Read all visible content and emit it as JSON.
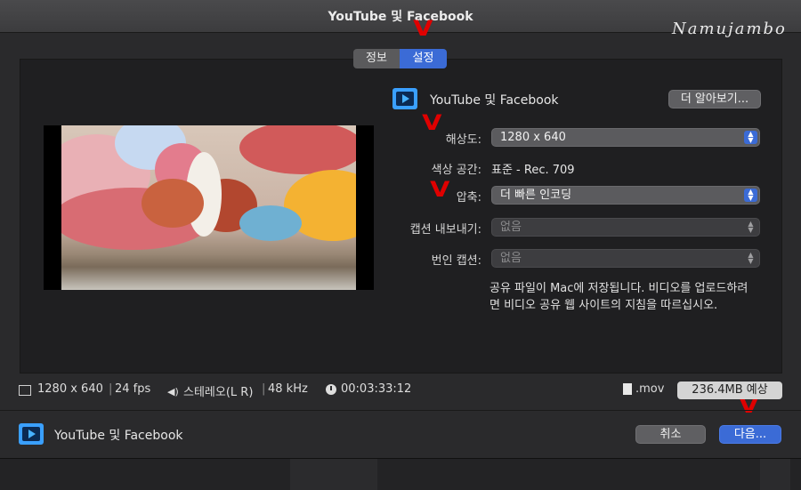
{
  "window": {
    "title": "YouTube 및 Facebook"
  },
  "watermark": "Namujambo",
  "tabs": [
    {
      "label": "정보",
      "selected": false
    },
    {
      "label": "설정",
      "selected": true
    }
  ],
  "destination": {
    "name": "YouTube 및 Facebook",
    "learn_more": "더 알아보기..."
  },
  "settings": {
    "resolution": {
      "label": "해상도:",
      "value": "1280 x 640"
    },
    "color_space": {
      "label": "색상 공간:",
      "value": "표준 - Rec. 709"
    },
    "compression": {
      "label": "압축:",
      "value": "더 빠른 인코딩"
    },
    "caption_export": {
      "label": "캡션 내보내기:",
      "value": "없음"
    },
    "translated_caption": {
      "label": "번인 캡션:",
      "value": "없음"
    }
  },
  "description": "공유 파일이 Mac에 저장됩니다. 비디오를 업로드하려면 비디오 공유 웹 사이트의 지침을 따르십시오.",
  "status": {
    "resolution": "1280 x 640",
    "fps": "24 fps",
    "audio": "스테레오(L R)",
    "sample_rate": "48 kHz",
    "duration": "00:03:33:12",
    "file_ext": ".mov",
    "size_estimate": "236.4MB 예상"
  },
  "footer": {
    "label": "YouTube 및 Facebook",
    "cancel": "취소",
    "next": "다음..."
  },
  "annotation_mark": "V",
  "colors": {
    "accent": "#3b6bd6",
    "annotation": "#e00000"
  }
}
